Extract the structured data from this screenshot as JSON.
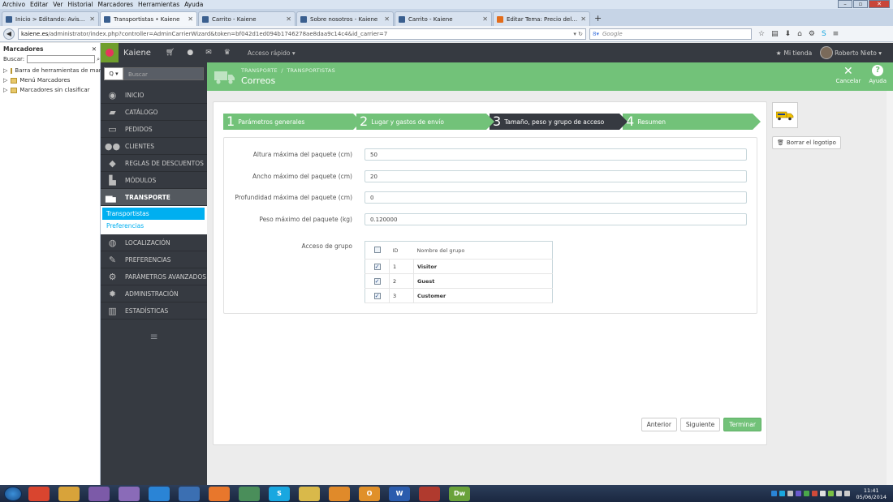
{
  "browser": {
    "menu": [
      "Archivo",
      "Editar",
      "Ver",
      "Historial",
      "Marcadores",
      "Herramientas",
      "Ayuda"
    ],
    "tabs": [
      {
        "label": "Inicio > Editando: Aviso le...",
        "active": false
      },
      {
        "label": "Transportistas • Kaiene",
        "active": true
      },
      {
        "label": "Carrito - Kaiene",
        "active": false
      },
      {
        "label": "Sobre nosotros - Kaiene",
        "active": false
      },
      {
        "label": "Carrito - Kaiene",
        "active": false
      },
      {
        "label": "Editar Tema: Precio del env...",
        "active": false
      }
    ],
    "new_tab": "+",
    "url_domain": "kaiene.es",
    "url_path": "/administrator/index.php?controller=AdminCarrierWizard&token=bf042d1ed094b1746278ae8daa9c14c4&id_carrier=7",
    "search_placeholder": "Google"
  },
  "bookmarks": {
    "title": "Marcadores",
    "search_label": "Buscar:",
    "items": [
      "Barra de herramientas de marca...",
      "Menú Marcadores",
      "Marcadores sin clasificar"
    ]
  },
  "header": {
    "shop_name": "Kaiene",
    "quick_access": "Acceso rápido ▾",
    "my_shop": "Mi tienda",
    "user": "Roberto Nieto ▾"
  },
  "nav": {
    "search_btn": "Q ▾",
    "search_placeholder": "Buscar",
    "items": [
      {
        "label": "INICIO",
        "icon": "dashboard-icon"
      },
      {
        "label": "CATÁLOGO",
        "icon": "book-icon"
      },
      {
        "label": "PEDIDOS",
        "icon": "credit-card-icon"
      },
      {
        "label": "CLIENTES",
        "icon": "users-icon"
      },
      {
        "label": "REGLAS DE DESCUENTOS",
        "icon": "tags-icon"
      },
      {
        "label": "MÓDULOS",
        "icon": "puzzle-icon"
      },
      {
        "label": "TRANSPORTE",
        "icon": "truck-icon"
      }
    ],
    "sub_items": [
      "Transportistas",
      "Preferencias"
    ],
    "items_after": [
      {
        "label": "LOCALIZACIÓN",
        "icon": "globe-icon"
      },
      {
        "label": "PREFERENCIAS",
        "icon": "wrench-icon"
      },
      {
        "label": "PARÁMETROS AVANZADOS",
        "icon": "cogs-icon"
      },
      {
        "label": "ADMINISTRACIÓN",
        "icon": "cog-icon"
      },
      {
        "label": "ESTADÍSTICAS",
        "icon": "bar-chart-icon"
      }
    ],
    "menu_toggle": "≡"
  },
  "toolbar": {
    "breadcrumb_1": "TRANSPORTE",
    "breadcrumb_sep": "/",
    "breadcrumb_2": "TRANSPORTISTAS",
    "title": "Correos",
    "cancel": "Cancelar",
    "help": "Ayuda"
  },
  "steps": [
    {
      "num": "1",
      "label": "Parámetros generales"
    },
    {
      "num": "2",
      "label": "Lugar y gastos de envío"
    },
    {
      "num": "3",
      "label": "Tamaño, peso y grupo de acceso"
    },
    {
      "num": "4",
      "label": "Resumen"
    }
  ],
  "form": {
    "max_height_label": "Altura máxima del paquete (cm)",
    "max_height_value": "50",
    "max_width_label": "Ancho máximo del paquete (cm)",
    "max_width_value": "20",
    "max_depth_label": "Profundidad máxima del paquete (cm)",
    "max_depth_value": "0",
    "max_weight_label": "Peso máximo del paquete (kg)",
    "max_weight_value": "0.120000",
    "group_access_label": "Acceso de grupo",
    "group_table": {
      "col_id": "ID",
      "col_name": "Nombre del grupo",
      "rows": [
        {
          "id": "1",
          "name": "Visitor",
          "checked": true
        },
        {
          "id": "2",
          "name": "Guest",
          "checked": true
        },
        {
          "id": "3",
          "name": "Customer",
          "checked": true
        }
      ]
    }
  },
  "buttons": {
    "prev": "Anterior",
    "next": "Siguiente",
    "finish": "Terminar"
  },
  "logo": {
    "delete": "Borrar el logotipo"
  },
  "taskbar": {
    "apps": [
      {
        "name": "chrome",
        "label": "",
        "color": "#d9452f"
      },
      {
        "name": "paint",
        "label": "",
        "color": "#d8a33a"
      },
      {
        "name": "app-purple-1",
        "label": "",
        "color": "#7c5aa8"
      },
      {
        "name": "app-purple-2",
        "label": "",
        "color": "#8a6bb8"
      },
      {
        "name": "dropbox",
        "label": "",
        "color": "#2a84d6"
      },
      {
        "name": "app-blue",
        "label": "",
        "color": "#3b6fb2"
      },
      {
        "name": "firefox",
        "label": "",
        "color": "#e8772c"
      },
      {
        "name": "app-network",
        "label": "",
        "color": "#4a8e5a"
      },
      {
        "name": "skype",
        "label": "S",
        "color": "#19a7e0"
      },
      {
        "name": "explorer",
        "label": "",
        "color": "#d9b94a"
      },
      {
        "name": "media-player",
        "label": "",
        "color": "#e08a2a"
      },
      {
        "name": "outlook",
        "label": "O",
        "color": "#e0902a"
      },
      {
        "name": "word",
        "label": "W",
        "color": "#2b5cad"
      },
      {
        "name": "app-red",
        "label": "",
        "color": "#b03a2e"
      },
      {
        "name": "dreamweaver",
        "label": "Dw",
        "color": "#6aa23a"
      }
    ],
    "time": "11:41",
    "date": "05/06/2014"
  },
  "colors": {
    "accent": "#72c279",
    "dark": "#363a41",
    "link": "#00aff0"
  }
}
